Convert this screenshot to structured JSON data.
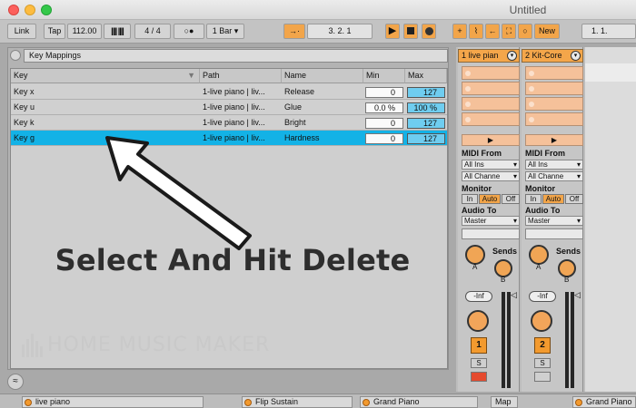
{
  "window": {
    "title": "Untitled"
  },
  "transport": {
    "link": "Link",
    "tap": "Tap",
    "tempo": "112.00",
    "meter": "4 / 4",
    "quantize": "1 Bar",
    "position": "3.   2.   1",
    "new_label": "New",
    "loop_start": "1.   1."
  },
  "key_mappings": {
    "title": "Key Mappings",
    "columns": [
      "Key",
      "Path",
      "Name",
      "Min",
      "Max"
    ],
    "rows": [
      {
        "key": "Key x",
        "path": "1-live piano | liv...",
        "name": "Release",
        "min": "0",
        "max": "127"
      },
      {
        "key": "Key u",
        "path": "1-live piano | liv...",
        "name": "Glue",
        "min": "0.0 %",
        "max": "100 %"
      },
      {
        "key": "Key k",
        "path": "1-live piano | liv...",
        "name": "Bright",
        "min": "0",
        "max": "127"
      },
      {
        "key": "Key g",
        "path": "1-live piano | liv...",
        "name": "Hardness",
        "min": "0",
        "max": "127",
        "selected": true
      }
    ]
  },
  "overlay": {
    "headline": "Select And Hit Delete",
    "watermark": "HOME MUSIC MAKER"
  },
  "mixer": {
    "tracks": [
      {
        "name": "1 live pian",
        "number": "1",
        "midi_from": "MIDI From",
        "input": "All Ins",
        "channel": "All Channe",
        "monitor": "Monitor",
        "mon_in": "In",
        "mon_auto": "Auto",
        "mon_off": "Off",
        "audio_to": "Audio To",
        "output": "Master",
        "sends": "Sends",
        "send_a": "A",
        "send_b": "B",
        "volume": "-Inf",
        "solo": "S"
      },
      {
        "name": "2 Kit-Core",
        "number": "2",
        "midi_from": "MIDI From",
        "input": "All Ins",
        "channel": "All Channe",
        "monitor": "Monitor",
        "mon_in": "In",
        "mon_auto": "Auto",
        "mon_off": "Off",
        "audio_to": "Audio To",
        "output": "Master",
        "sends": "Sends",
        "send_a": "A",
        "send_b": "B",
        "volume": "-Inf",
        "solo": "S"
      }
    ]
  },
  "devices": {
    "items": [
      "live piano",
      "Flip Sustain",
      "Grand Piano",
      "Grand Piano"
    ],
    "map_label": "Map"
  },
  "colors": {
    "accent": "#f4a64a",
    "selection": "#13b2e6",
    "max_field": "#6fcdf0"
  }
}
